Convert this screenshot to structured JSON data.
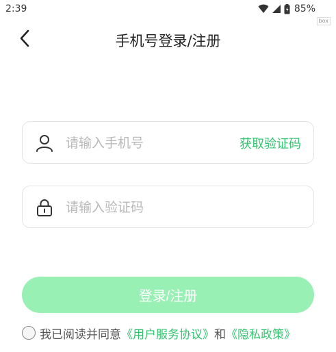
{
  "status_bar": {
    "time": "2:39",
    "battery": "85%",
    "box_tag": "box"
  },
  "nav": {
    "title": "手机号登录/注册",
    "back_icon": "chevron-left-icon"
  },
  "phone_field": {
    "placeholder": "请输入手机号",
    "value": "",
    "icon": "user-icon",
    "get_code_label": "获取验证码"
  },
  "code_field": {
    "placeholder": "请输入验证码",
    "value": "",
    "icon": "lock-icon"
  },
  "login_button": {
    "label": "登录/注册",
    "color": "#98f0b4"
  },
  "agreement": {
    "checked": false,
    "prefix": "我已阅读并同意",
    "user_agreement": "《用户服务协议》",
    "and": "和",
    "privacy_policy": "《隐私政策》"
  },
  "colors": {
    "accent": "#33c46f",
    "placeholder": "#b9b9b9",
    "border": "#e3e3e3"
  }
}
